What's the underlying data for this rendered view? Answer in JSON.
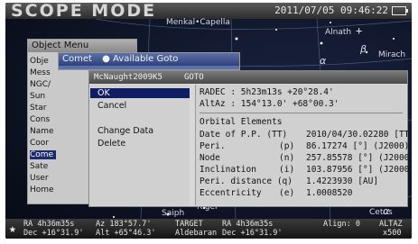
{
  "header": {
    "title": "SCOPE MODE",
    "datetime": "2011/07/05 09:46:22"
  },
  "sky_labels": [
    {
      "name": "Menkalinan",
      "text": "Menkal•Capella"
    },
    {
      "name": "Alnath",
      "text": "Alnath"
    },
    {
      "name": "Mirach",
      "text": "Mirach"
    },
    {
      "name": "Saiph",
      "text": "Saiph"
    },
    {
      "name": "Rigel",
      "text": "Rigel"
    },
    {
      "name": "Cetus",
      "text": "Cetus"
    }
  ],
  "object_menu": {
    "title": "Object Menu",
    "items": [
      "Obje",
      "Mess",
      "NGC/",
      "Sun",
      "Star",
      "Cons",
      "Name",
      "Coor",
      "Come",
      "Sate",
      "User",
      "Home"
    ],
    "selected_index": 8
  },
  "comet_panel": {
    "title_left": "Comet",
    "title_right": "Available Goto"
  },
  "detail": {
    "name": "McNaught2009K5",
    "goto": "GOTO",
    "actions": [
      "OK",
      "Cancel",
      "Change Data",
      "Delete"
    ],
    "selected_action": 0,
    "radec_label": "RADEC",
    "radec_value": "5h23m13s +20°28.4'",
    "altaz_label": "AltAz",
    "altaz_value": "154°13.0' +68°00.3'",
    "orbital_heading": "Orbital Elements",
    "elements": [
      {
        "label": "Date of P.P.",
        "sym": "(TT)",
        "value": "2010/04/30.02280 [TT]"
      },
      {
        "label": "Peri.",
        "sym": "(p)",
        "value": "86.17274 [°] (J2000)"
      },
      {
        "label": "Node",
        "sym": "(n)",
        "value": "257.85578 [°] (J2000)"
      },
      {
        "label": "Inclination",
        "sym": "(i)",
        "value": "103.87956 [°] (J2000)"
      },
      {
        "label": "Peri. distance",
        "sym": "(q)",
        "value": "1.4223930 [AU]"
      },
      {
        "label": "Eccentricity",
        "sym": "(e)",
        "value": "1.0008520"
      }
    ]
  },
  "status": {
    "ra_label": "RA",
    "ra_value": "4h36m35s",
    "dec_label": "Dec",
    "dec_value": "+16°31.9'",
    "az_label": "Az",
    "az_value": "183°57.7'",
    "alt_label": "Alt",
    "alt_value": "+65°46.3'",
    "target_label": "TARGET",
    "target_name": "Aldebaran",
    "t_ra_label": "RA",
    "t_ra_value": "4h36m35s",
    "t_dec_label": "Dec",
    "t_dec_value": "+16°31.9'",
    "align": "Align: 0",
    "altaz_mode": "ALTAZ",
    "zoom": "x500"
  }
}
